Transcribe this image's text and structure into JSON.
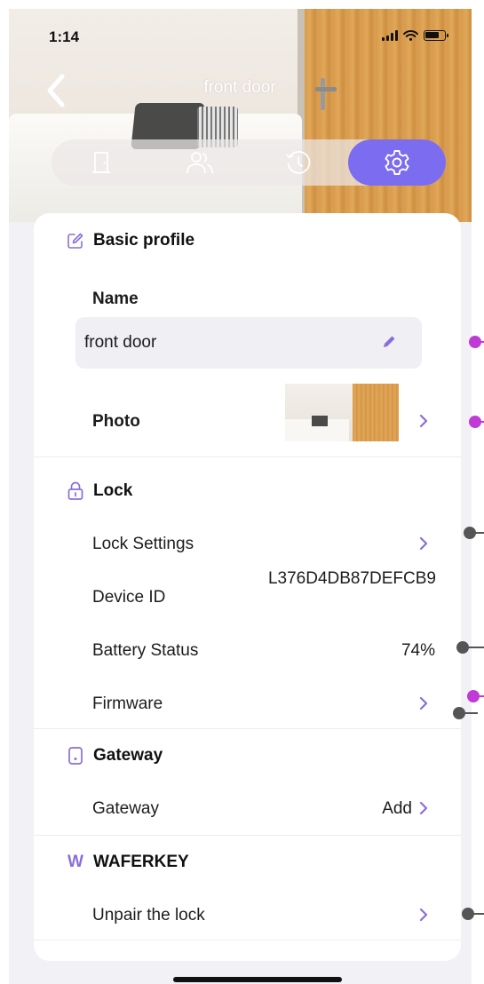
{
  "status_bar": {
    "time": "1:14"
  },
  "header": {
    "title": "front door"
  },
  "tabs": [
    {
      "name": "door",
      "icon": "door-icon",
      "active": false
    },
    {
      "name": "users",
      "icon": "users-icon",
      "active": false
    },
    {
      "name": "history",
      "icon": "history-icon",
      "active": false
    },
    {
      "name": "settings",
      "icon": "gear-icon",
      "active": true
    }
  ],
  "basic_profile": {
    "title": "Basic profile",
    "name_label": "Name",
    "name_value": "front door",
    "photo_label": "Photo"
  },
  "lock": {
    "title": "Lock",
    "lock_settings_label": "Lock Settings",
    "device_id_label": "Device ID",
    "device_id_value": "L376D4DB87DEFCB9",
    "battery_label": "Battery Status",
    "battery_value": "74%",
    "firmware_label": "Firmware"
  },
  "gateway": {
    "title": "Gateway",
    "gateway_label": "Gateway",
    "gateway_action": "Add"
  },
  "waferkey": {
    "logo": "W",
    "title": "WAFERKEY",
    "unpair_label": "Unpair the lock"
  },
  "colors": {
    "accent": "#7b6cf0",
    "icon_purple": "#8a6fd8",
    "marker_pink": "#c03ad6",
    "marker_gray": "#555555"
  }
}
